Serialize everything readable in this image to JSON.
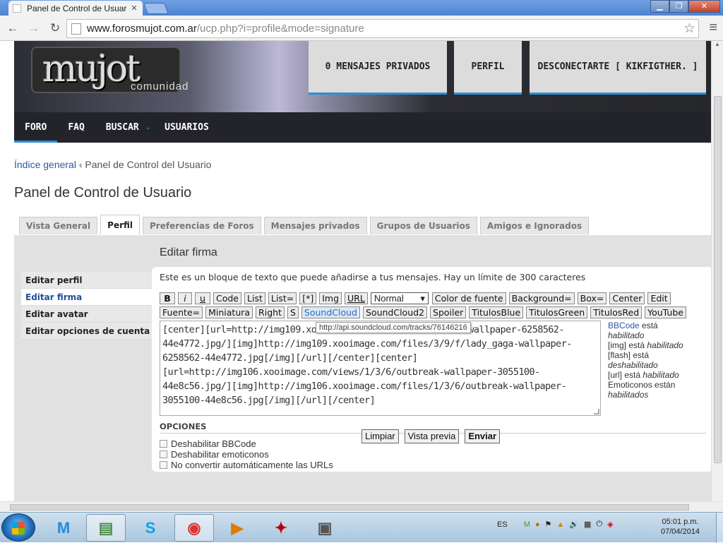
{
  "browser": {
    "tab_title": "Panel de Control de Usuar",
    "url_host": "www.forosmujot.com.ar",
    "url_path": "/ucp.php?i=profile&mode=signature"
  },
  "site": {
    "logo": "mujot",
    "logo_sub": "comunidad",
    "top_boxes": [
      "0 MENSAJES PRIVADOS",
      "PERFIL",
      "DESCONECTARTE [ KIKFIGTHER. ]"
    ],
    "nav": [
      "FORO",
      "FAQ",
      "BUSCAR",
      "USUARIOS"
    ]
  },
  "breadcrumb": {
    "home": "Índice general",
    "sep": " ‹ ",
    "current": "Panel de Control del Usuario"
  },
  "page_title": "Panel de Control de Usuario",
  "tabs": [
    "Vista General",
    "Perfil",
    "Preferencias de Foros",
    "Mensajes privados",
    "Grupos de Usuarios",
    "Amigos e Ignorados"
  ],
  "sidebar": [
    "Editar perfil",
    "Editar firma",
    "Editar avatar",
    "Editar opciones de cuenta"
  ],
  "panel_title": "Editar firma",
  "description": "Este es un bloque de texto que puede añadirse a tus mensajes. Hay un límite de 300 caracteres",
  "bbcode_row1": [
    "B",
    "i",
    "u",
    "Code",
    "List",
    "List=",
    "[*]",
    "Img",
    "URL"
  ],
  "font_size_select": "Normal",
  "bbcode_row1b": [
    "Color de fuente",
    "Background=",
    "Box=",
    "Center",
    "Edit"
  ],
  "bbcode_row2": [
    "Fuente=",
    "Miniatura",
    "Right",
    "S",
    "SoundCloud",
    "SoundCloud2",
    "Spoiler",
    "TitulosBlue",
    "TitulosGreen",
    "TitulosRed",
    "YouTube"
  ],
  "tooltip": "http://api.soundcloud.com/tracks/76146216",
  "signature_lines": [
    "[center][url=http://img109.xooi",
    "44e4772.jpg/][img]http://img109.xooimage.com/files/3/9/f/lady_gaga-wallpaper-",
    "6258562-44e4772.jpg[/img][/url][/center][center]",
    "[url=http://img106.xooimage.com/views/1/3/6/outbreak-wallpaper-3055100-",
    "44e8c56.jpg/][img]http://img106.xooimage.com/files/1/3/6/outbreak-wallpaper-",
    "3055100-44e8c56.jpg[/img][/url][/center]"
  ],
  "signature_line1_tail": "wallpaper-6258562-",
  "status": {
    "bbcode_link": "BBCode",
    "bbcode_state": " está",
    "bbcode_val": "habilitado",
    "img": "[img] está ",
    "img_val": "habilitado",
    "flash": "[flash] está",
    "flash_val": "deshabilitado",
    "url": "[url] está ",
    "url_val": "habilitado",
    "emot": "Emoticonos están",
    "emot_val": "habilitados"
  },
  "options_title": "OPCIONES",
  "options": [
    "Deshabilitar BBCode",
    "Deshabilitar emoticonos",
    "No convertir automáticamente las URLs"
  ],
  "actions": [
    "Limpiar",
    "Vista previa",
    "Enviar"
  ],
  "taskbar": {
    "lang": "ES",
    "time": "05:01 p.m.",
    "date": "07/04/2014"
  },
  "colors": {
    "accent": "#2d8fd5",
    "link": "#2f58a4",
    "nav_bg": "#23242a"
  }
}
